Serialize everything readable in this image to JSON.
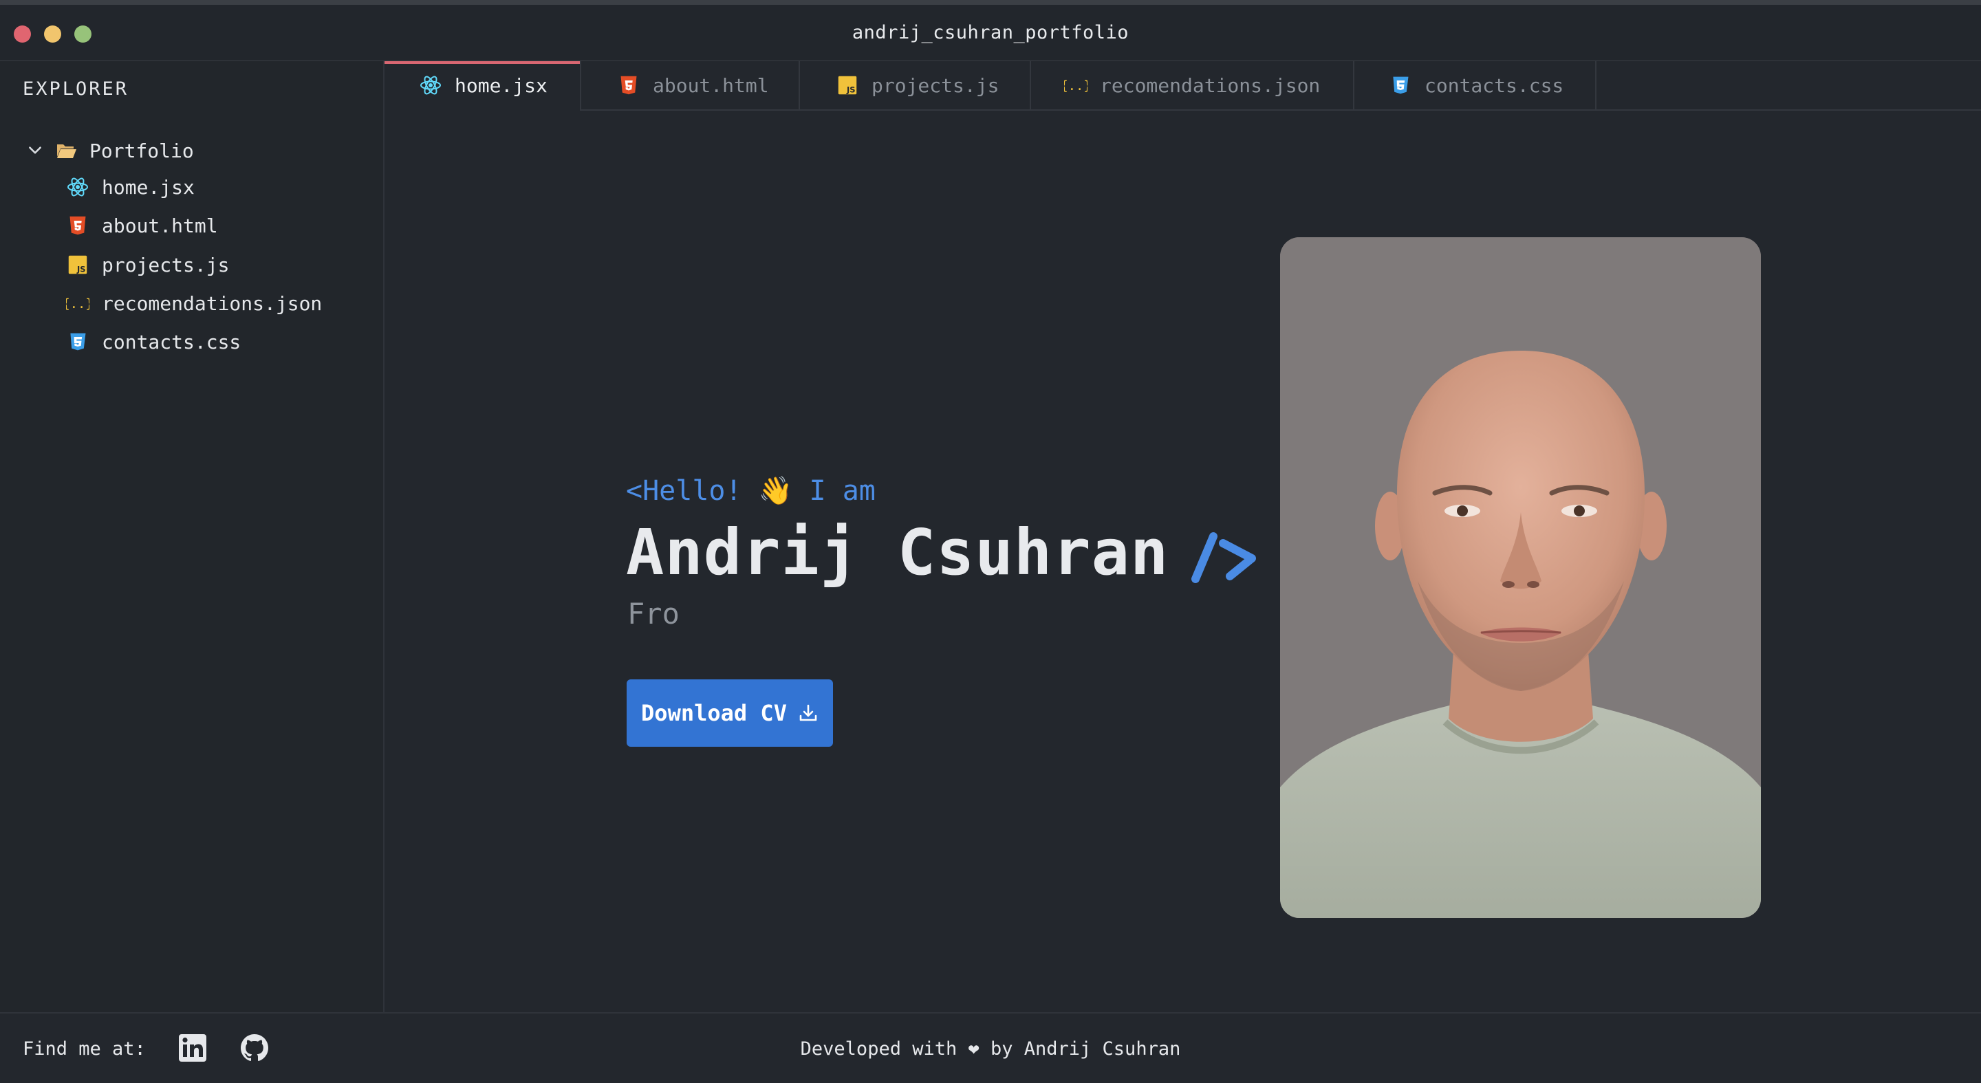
{
  "window": {
    "title": "andrij_csuhran_portfolio",
    "controls": [
      "close",
      "minimize",
      "maximize"
    ]
  },
  "sidebar": {
    "title": "EXPLORER",
    "folder": {
      "label": "Portfolio",
      "expanded": true,
      "icon": "folder-open-icon"
    },
    "files": [
      {
        "label": "home.jsx",
        "icon": "react-icon"
      },
      {
        "label": "about.html",
        "icon": "html5-icon"
      },
      {
        "label": "projects.js",
        "icon": "javascript-icon"
      },
      {
        "label": "recomendations.json",
        "icon": "json-icon"
      },
      {
        "label": "contacts.css",
        "icon": "css3-icon"
      }
    ]
  },
  "tabs": [
    {
      "label": "home.jsx",
      "icon": "react-icon",
      "active": true
    },
    {
      "label": "about.html",
      "icon": "html5-icon",
      "active": false
    },
    {
      "label": "projects.js",
      "icon": "javascript-icon",
      "active": false
    },
    {
      "label": "recomendations.json",
      "icon": "json-icon",
      "active": false
    },
    {
      "label": "contacts.css",
      "icon": "css3-icon",
      "active": false
    }
  ],
  "hero": {
    "greeting": "<Hello! 👋 I am",
    "name": "Andrij Csuhran",
    "role_typed": "Fro",
    "cv_button": "Download CV"
  },
  "footer": {
    "find_me": "Find me at:",
    "social": [
      "linkedin-icon",
      "github-icon"
    ],
    "credit": "Developed with ❤ by Andrij Csuhran"
  },
  "colors": {
    "background": "#23272d",
    "accent_blue": "#3374d3",
    "greeting_blue": "#4d8ee6",
    "active_tab_border": "#d96772",
    "react": "#61dafb",
    "html": "#e44d26",
    "js": "#f0c23b",
    "json": "#f0c23b",
    "css": "#3b9ee8"
  }
}
